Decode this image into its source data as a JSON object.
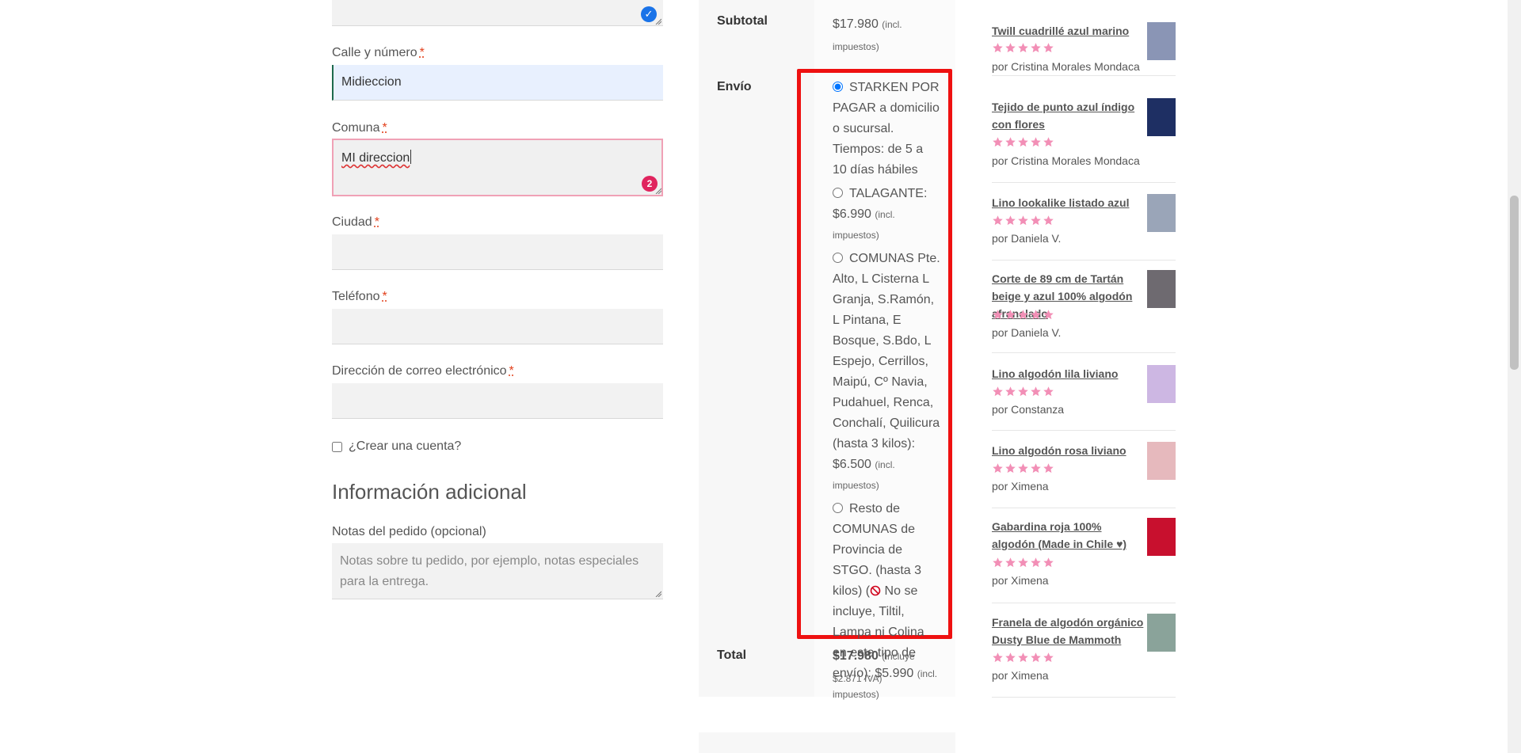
{
  "form": {
    "street_label": "Calle y número",
    "street_value": "Midieccion",
    "comuna_label": "Comuna",
    "comuna_value": "MI direccion",
    "comuna_error_count": "2",
    "city_label": "Ciudad",
    "phone_label": "Teléfono",
    "email_label": "Dirección de correo electrónico",
    "required_mark": "*",
    "create_account_label": "¿Crear una cuenta?",
    "additional_info_heading": "Información adicional",
    "notes_label": "Notas del pedido (opcional)",
    "notes_placeholder": "Notas sobre tu pedido, por ejemplo, notas especiales para la entrega."
  },
  "review": {
    "subtotal_label": "Subtotal",
    "subtotal_amount": "$17.980",
    "subtotal_tax": "(incl. impuestos)",
    "shipping_label": "Envío",
    "shipping_options": [
      {
        "text": "STARKEN POR PAGAR a domicilio o sucursal. Tiempos: de 5 a 10 días hábiles",
        "price": "",
        "tax": "",
        "selected": true
      },
      {
        "text": "TALAGANTE: ",
        "price": "$6.990",
        "tax": "(incl. impuestos)",
        "selected": false
      },
      {
        "text": "COMUNAS Pte. Alto, L Cisterna L Granja, S.Ramón, L Pintana, E Bosque, S.Bdo, L Espejo, Cerrillos, Maipú, Cº Navia, Pudahuel, Renca, Conchalí, Quilicura (hasta 3 kilos): ",
        "price": "$6.500",
        "tax": "(incl. impuestos)",
        "selected": false
      },
      {
        "text_before": "Resto de COMUNAS de Provincia de STGO. (hasta 3 kilos) (",
        "text_after": " No se incluye, Tiltil, Lampa ni Colina en este tipo de envío): ",
        "price": "$5.990",
        "tax": "(incl. impuestos)",
        "selected": false
      }
    ],
    "total_label": "Total",
    "total_amount": "$17.980",
    "total_tax": "(incluye $2.871 IVA)"
  },
  "products": [
    {
      "title": "Twill cuadrillé azul marino",
      "reviewer": "por Cristina Morales Mondaca",
      "rating": 5,
      "thumb_color": "#8a95b5"
    },
    {
      "title": "Tejido de punto azul índigo con flores",
      "reviewer": "por Cristina Morales Mondaca",
      "rating": 5,
      "thumb_color": "#1e2f63"
    },
    {
      "title": "Lino lookalike listado azul",
      "reviewer": "por Daniela V.",
      "rating": 5,
      "thumb_color": "#9aa5b8"
    },
    {
      "title": "Corte de 89 cm de Tartán beige y azul 100% algodón afranelado",
      "reviewer": "por Daniela V.",
      "rating": 5,
      "thumb_color": "#6e6a70"
    },
    {
      "title": "Lino algodón lila liviano",
      "reviewer": "por Constanza",
      "rating": 5,
      "thumb_color": "#cdb7e3"
    },
    {
      "title": "Lino algodón rosa liviano",
      "reviewer": "por Ximena",
      "rating": 5,
      "thumb_color": "#e6b9bd"
    },
    {
      "title": "Gabardina roja 100% algodón (Made in Chile ♥)",
      "reviewer": "por Ximena",
      "rating": 5,
      "thumb_color": "#c8102e"
    },
    {
      "title": "Franela de algodón orgánico Dusty Blue de Mammoth",
      "reviewer": "por Ximena",
      "rating": 5,
      "thumb_color": "#8aa39a"
    }
  ],
  "colors": {
    "star": "#f28fb6",
    "highlight_border": "#ee1111",
    "required": "#e2401c"
  }
}
